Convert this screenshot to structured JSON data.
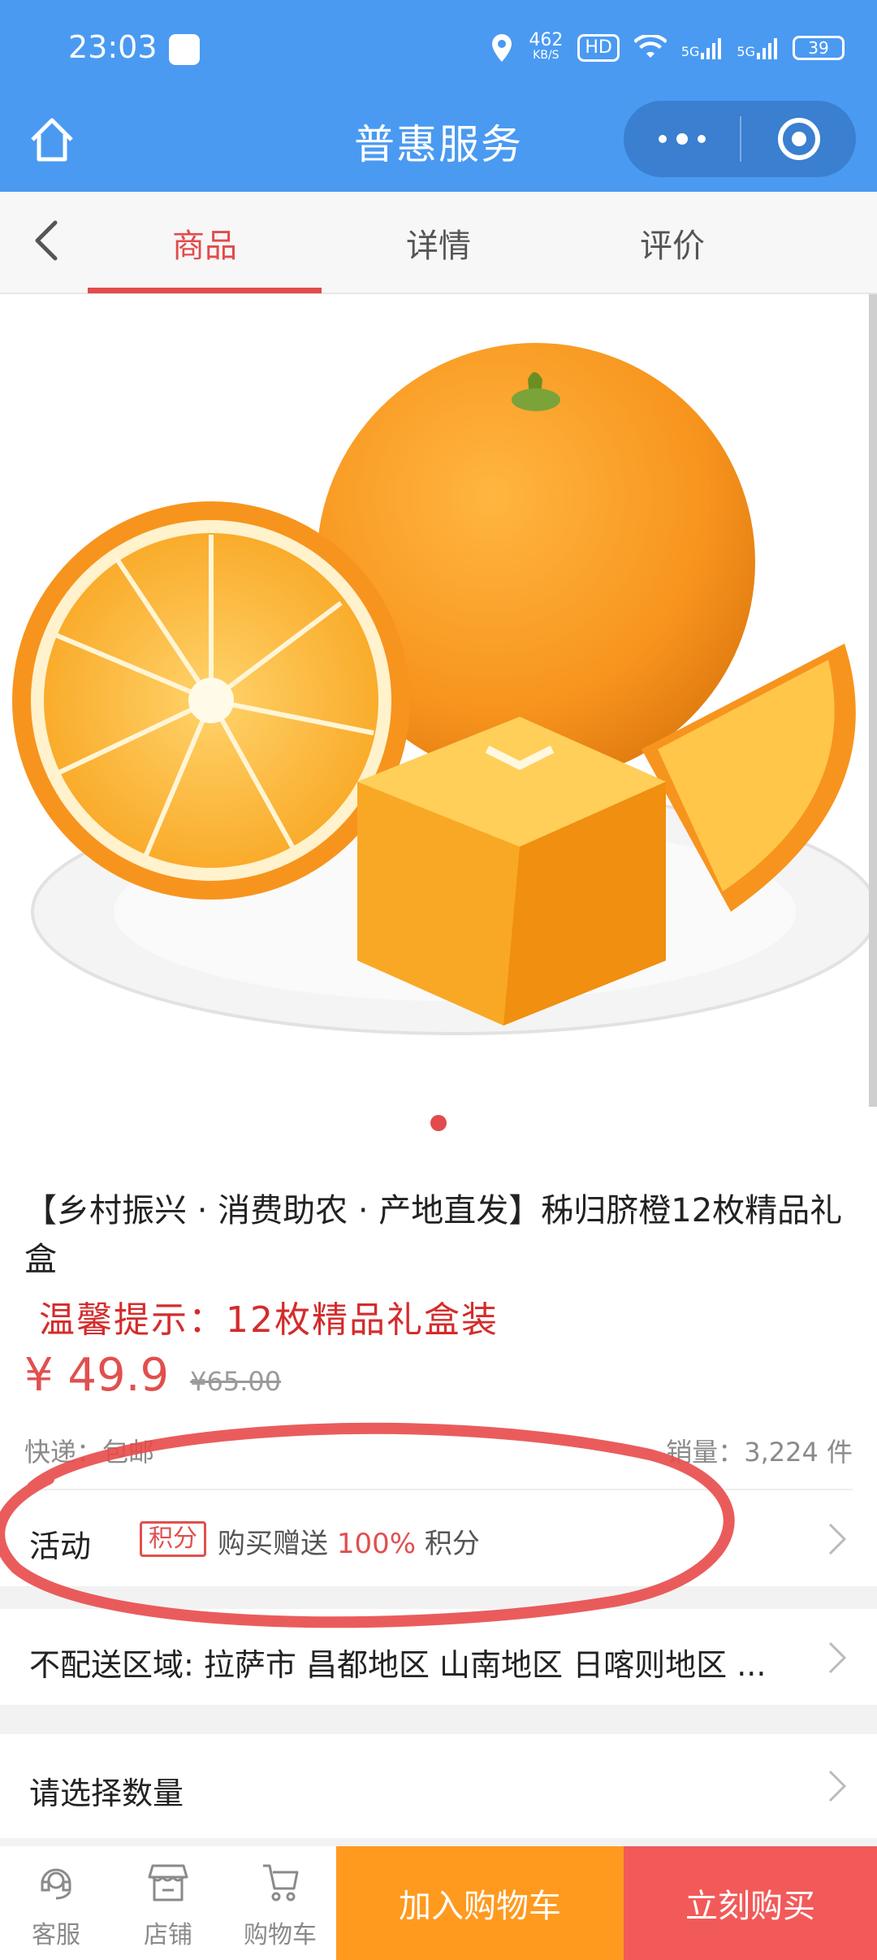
{
  "status_bar": {
    "time": "23:03",
    "net_speed": "462",
    "net_unit": "KB/S",
    "hd_label": "HD",
    "sig1": "5G",
    "sig2": "5G",
    "battery": "39"
  },
  "nav": {
    "title": "普惠服务"
  },
  "tabs": [
    {
      "label": "商品",
      "active": true
    },
    {
      "label": "详情",
      "active": false
    },
    {
      "label": "评价",
      "active": false
    }
  ],
  "product": {
    "title": "【乡村振兴 · 消费助农 · 产地直发】秭归脐橙12枚精品礼盒",
    "tip": "温馨提示：12枚精品礼盒装",
    "price": "¥ 49.9",
    "original_price": "¥65.00",
    "shipping": "快递：包邮",
    "sales": "销量：3,224 件"
  },
  "activity": {
    "label": "活动",
    "badge": "积分",
    "text_before": "购买赠送",
    "highlight": "100%",
    "text_after": "积分"
  },
  "delivery": {
    "text": "不配送区域: 拉萨市 昌都地区 山南地区 日喀则地区 ..."
  },
  "quantity": {
    "text": "请选择数量"
  },
  "bottom_bar": {
    "service": "客服",
    "shop": "店铺",
    "cart": "购物车",
    "add_to_cart": "加入购物车",
    "buy_now": "立刻购买"
  },
  "colors": {
    "header_blue": "#4a9af2",
    "accent_red": "#e24b4b",
    "orange_button": "#ff9a1f",
    "red_button": "#f25a5a"
  }
}
